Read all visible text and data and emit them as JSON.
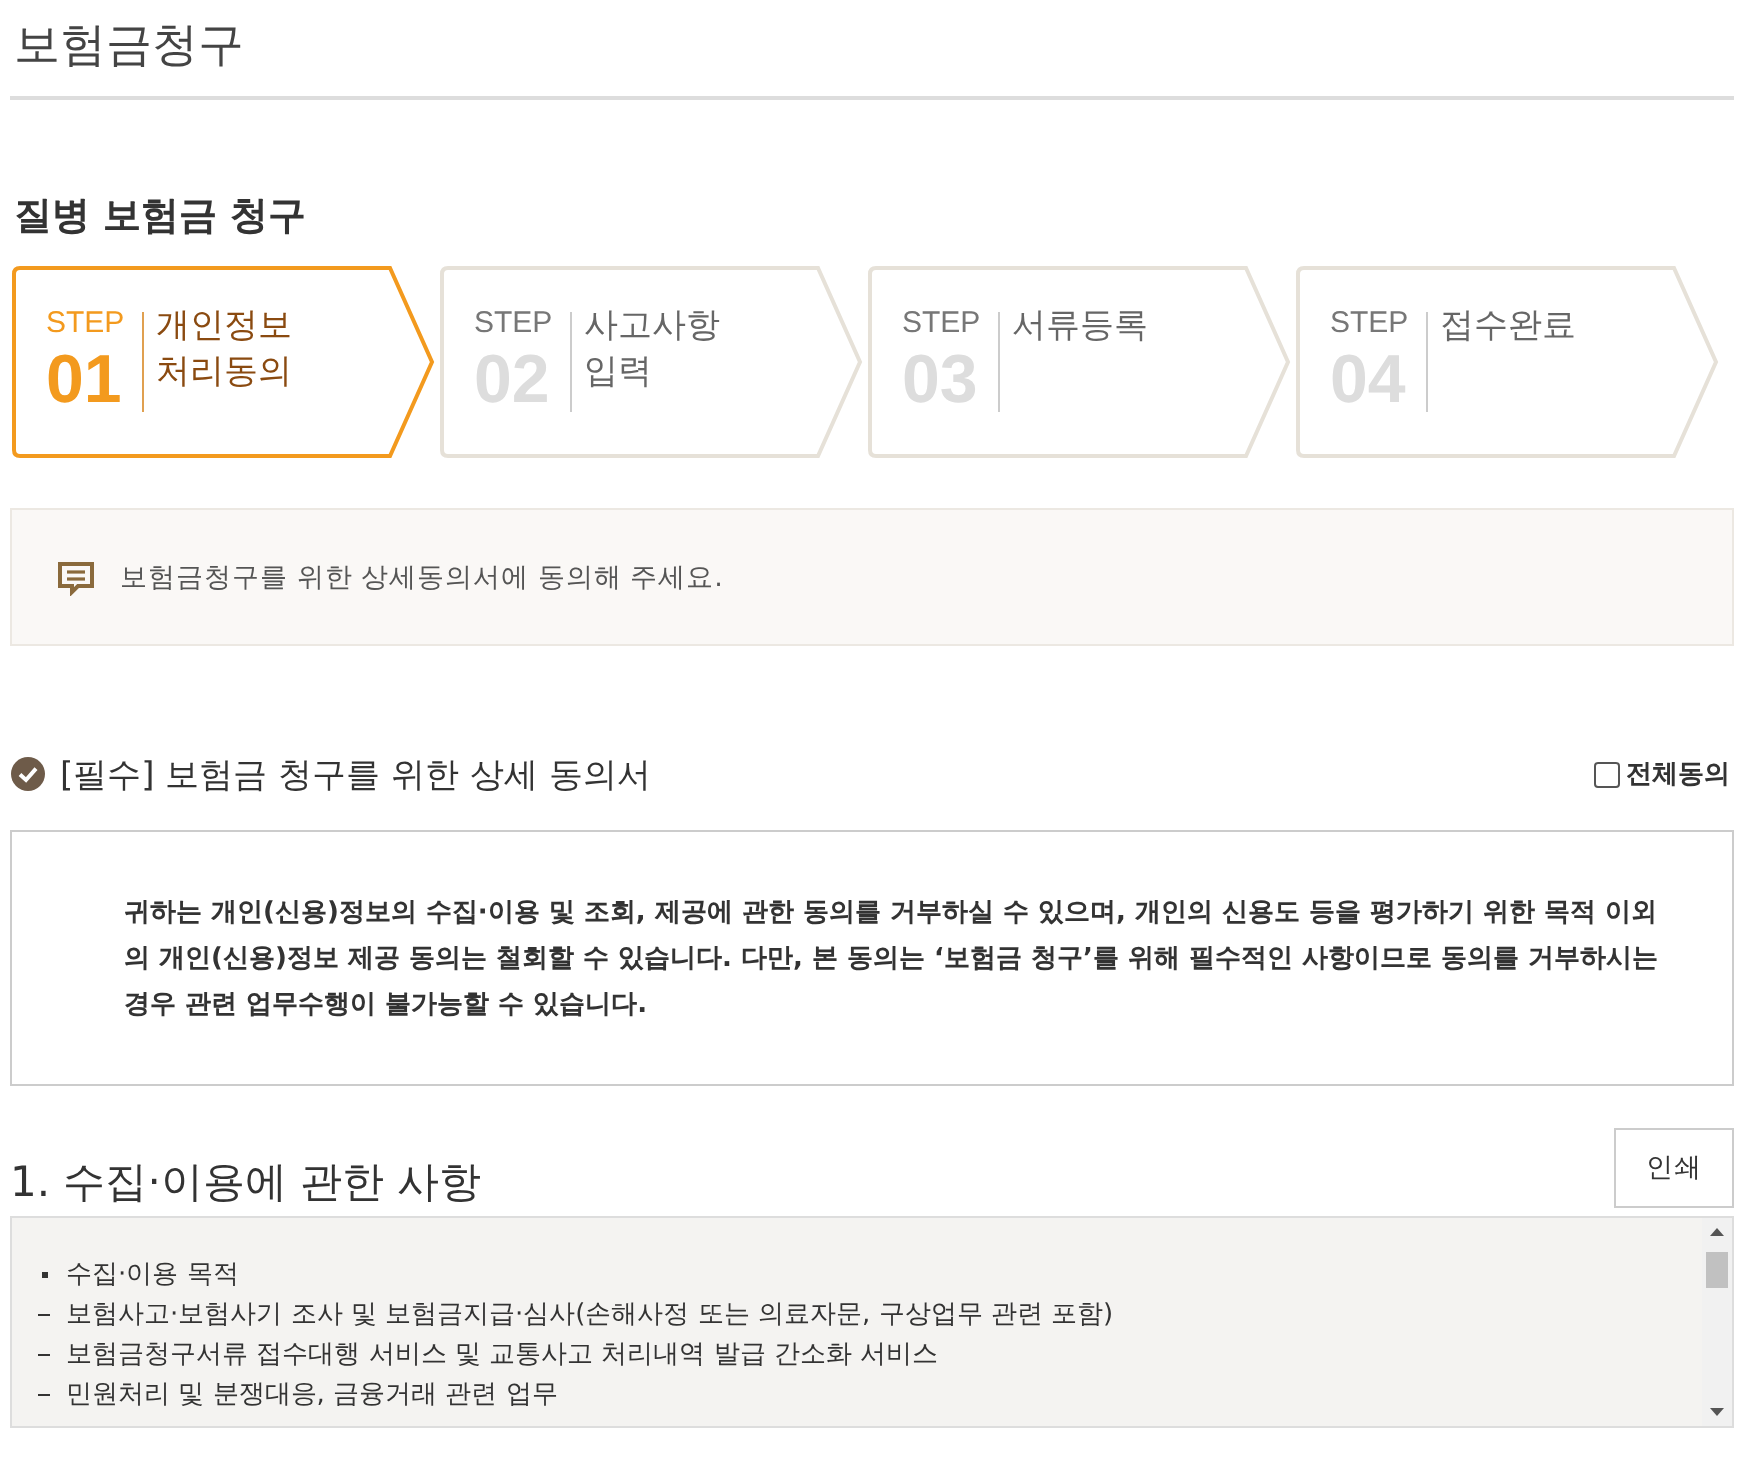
{
  "page_title": "보험금청구",
  "section_title": "질병 보험금 청구",
  "steps": [
    {
      "step_label": "STEP",
      "number": "01",
      "title": "개인정보\n처리동의",
      "selected": true
    },
    {
      "step_label": "STEP",
      "number": "02",
      "title": "사고사항\n입력",
      "selected": false
    },
    {
      "step_label": "STEP",
      "number": "03",
      "title": "서류등록",
      "selected": false
    },
    {
      "step_label": "STEP",
      "number": "04",
      "title": "접수완료",
      "selected": false
    }
  ],
  "notice": "보험금청구를 위한 상세동의서에 동의해 주세요.",
  "consent": {
    "title": "[필수] 보험금 청구를 위한 상세 동의서",
    "agree_all": {
      "label": "전체동의",
      "checked": false
    },
    "text": "귀하는 개인(신용)정보의 수집·이용 및 조회, 제공에 관한 동의를 거부하실 수 있으며, 개인의 신용도 등을 평가하기 위한 목적 이외의 개인(신용)정보 제공 동의는 철회할 수 있습니다. 다만, 본 동의는 ‘보험금 청구’를 위해 필수적인 사항이므로 동의를 거부하시는 경우 관련 업무수행이 불가능할 수 있습니다."
  },
  "section": {
    "heading": "1. 수집·이용에 관한 사항",
    "print_button": "인쇄",
    "lines": [
      {
        "kind": "bullet",
        "text": "수집·이용 목적"
      },
      {
        "kind": "dash",
        "text": "보험사고·보험사기 조사 및 보험금지급·심사(손해사정 또는 의료자문, 구상업무 관련 포함)"
      },
      {
        "kind": "dash",
        "text": "보험금청구서류 접수대행 서비스 및 교통사고 처리내역 발급 간소화 서비스"
      },
      {
        "kind": "dash",
        "text": "민원처리 및 분쟁대응, 금융거래 관련 업무"
      }
    ]
  }
}
